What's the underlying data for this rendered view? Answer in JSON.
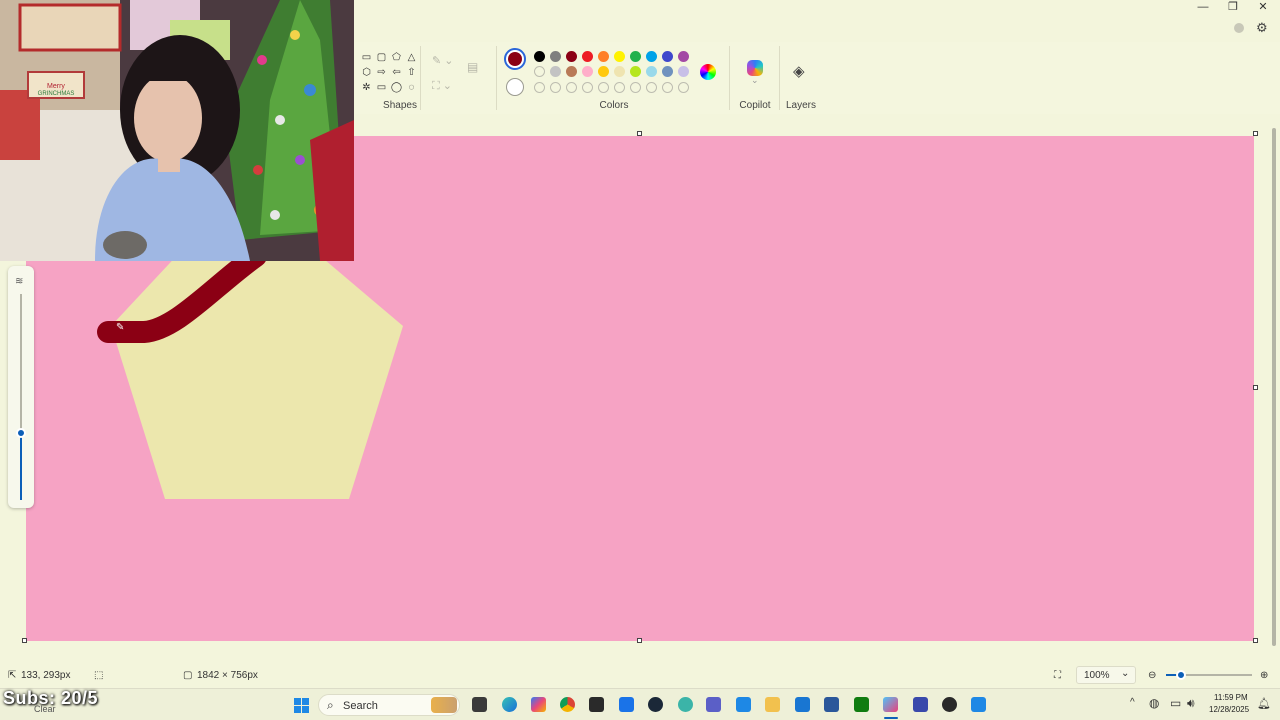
{
  "ribbon": {
    "shapes_label": "Shapes",
    "colors_label": "Colors",
    "copilot_label": "Copilot",
    "layers_label": "Layers",
    "current_color": "#8b0014",
    "palette_row1": [
      "#000000",
      "#7f7f7f",
      "#8b0014",
      "#ed1c24",
      "#ff7f27",
      "#fff200",
      "#22b14c",
      "#00a2e8",
      "#3f48cc",
      "#a349a4"
    ],
    "palette_row2": [
      "#ffffff",
      "#c3c3c3",
      "#b97a57",
      "#ffaec9",
      "#ffc90e",
      "#efe4b0",
      "#b5e61d",
      "#99d9ea",
      "#7092be",
      "#c8bfe7"
    ]
  },
  "canvas": {
    "background": "#f6a3c4",
    "shape_fill": "#ece7ad",
    "stroke_color": "#8b0014"
  },
  "status": {
    "cursor_position": "133, 293px",
    "canvas_size": "1842 × 756px",
    "zoom": "100%",
    "zoom_caret": "⌄"
  },
  "taskbar": {
    "search_placeholder": "Search",
    "time": "11:59 PM",
    "date": "12/28/2025",
    "clear_label": "Clear",
    "subs_overlay": "Subs: 20/5"
  },
  "webcam": {
    "sign_text": "Merry GRINCHMAS"
  }
}
